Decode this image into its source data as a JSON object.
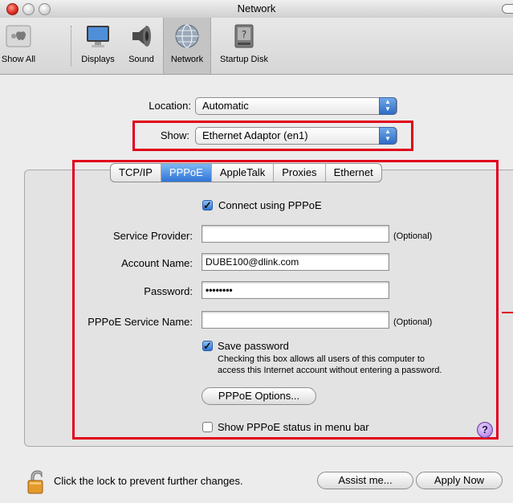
{
  "window": {
    "title": "Network"
  },
  "toolbar": {
    "items": [
      {
        "label": "Show All",
        "icon": "apple-icon"
      },
      {
        "label": "Displays",
        "icon": "display-icon"
      },
      {
        "label": "Sound",
        "icon": "speaker-icon"
      },
      {
        "label": "Network",
        "icon": "network-globe-icon",
        "selected": true
      },
      {
        "label": "Startup Disk",
        "icon": "startup-disk-icon"
      }
    ]
  },
  "location": {
    "label": "Location:",
    "value": "Automatic"
  },
  "show": {
    "label": "Show:",
    "value": "Ethernet Adaptor (en1)"
  },
  "tabs": [
    {
      "label": "TCP/IP",
      "selected": false
    },
    {
      "label": "PPPoE",
      "selected": true
    },
    {
      "label": "AppleTalk",
      "selected": false
    },
    {
      "label": "Proxies",
      "selected": false
    },
    {
      "label": "Ethernet",
      "selected": false
    }
  ],
  "pppoe": {
    "connect_label": "Connect using PPPoE",
    "connect_checked": true,
    "service_provider": {
      "label": "Service Provider:",
      "value": "",
      "hint": "(Optional)"
    },
    "account_name": {
      "label": "Account Name:",
      "value": "DUBE100@dlink.com"
    },
    "password": {
      "label": "Password:",
      "value": "••••••••"
    },
    "service_name": {
      "label": "PPPoE Service Name:",
      "value": "",
      "hint": "(Optional)"
    },
    "save_password_label": "Save password",
    "save_password_checked": true,
    "save_password_note_line1": "Checking this box allows all users of this computer to",
    "save_password_note_line2": "access this Internet account without entering a password.",
    "options_button": "PPPoE Options...",
    "status_menu_label": "Show PPPoE status in menu bar",
    "status_menu_checked": false,
    "help_glyph": "?"
  },
  "footer": {
    "lock_text": "Click the lock to prevent further changes.",
    "assist_button": "Assist me...",
    "apply_button": "Apply Now"
  },
  "colors": {
    "highlight_red": "#e0001b",
    "selection_blue": "#2f74d6"
  }
}
